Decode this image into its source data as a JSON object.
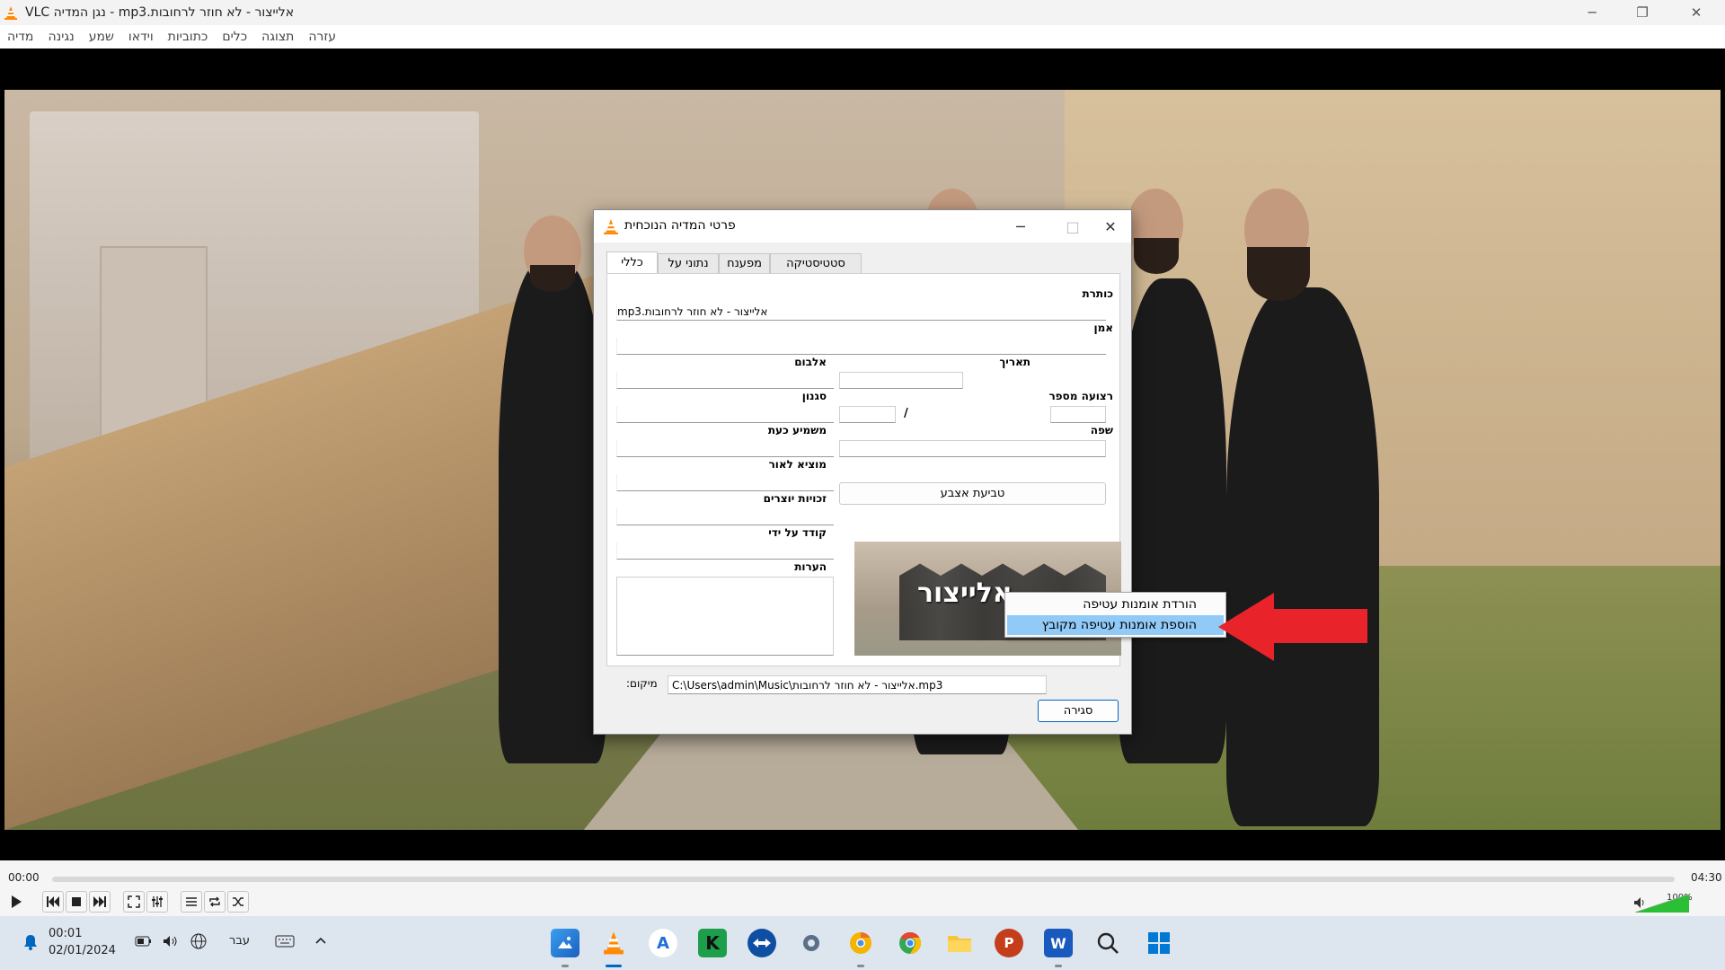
{
  "window": {
    "title": "אלייצור - לא חוזר לרחובות.mp3 - נגן המדיה VLC",
    "minimize": "─",
    "restore": "❐",
    "close": "✕"
  },
  "menu": [
    "מדיה",
    "נגינה",
    "שמע",
    "וידאו",
    "כתוביות",
    "כלים",
    "תצוגה",
    "עזרה"
  ],
  "dialog": {
    "title": "פרטי המדיה הנוכחית",
    "tabs": [
      "כללי",
      "נתוני על",
      "מפענח",
      "סטטיסטיקה"
    ],
    "fields": {
      "title_label": "כותרת",
      "title_value": "אלייצור - לא חוזר לרחובות.mp3",
      "artist_label": "אמן",
      "album_label": "אלבום",
      "date_label": "תאריך",
      "genre_label": "סגנון",
      "track_label": "רצועה מספר",
      "track_sep": "/",
      "now_playing_label": "משמיע כעת",
      "language_label": "שפה",
      "publisher_label": "מוציא לאור",
      "copyright_label": "זכויות יוצרים",
      "encoded_by_label": "קודד על ידי",
      "comments_label": "הערות"
    },
    "fingerprint_button": "טביעת אצבע",
    "art_text": "אלייצור",
    "location_label": "מיקום:",
    "location_value": "C:\\Users\\admin\\Music\\אלייצור - לא חוזר לרחובות.mp3",
    "close_button": "סגירה"
  },
  "context_menu": {
    "items": [
      {
        "label": "הורדת אומנות עטיפה",
        "highlighted": false
      },
      {
        "label": "הוספת אומנות עטיפה מקובץ",
        "highlighted": true
      }
    ]
  },
  "player": {
    "elapsed": "00:00",
    "total": "04:30",
    "progress_fraction": 0.0,
    "volume_label": "100%",
    "volume_fraction": 1.0
  },
  "taskbar": {
    "time": "00:01",
    "date": "02/01/2024",
    "language": "עבר",
    "apps": [
      "photos-icon",
      "vlc-icon",
      "app-store-icon",
      "kleopatra-icon",
      "teamviewer-icon",
      "settings-icon",
      "chrome-canary-icon",
      "chrome-icon",
      "file-explorer-icon",
      "powerpoint-icon",
      "word-icon",
      "search-icon",
      "start-icon"
    ]
  },
  "colors": {
    "accent_blue": "#0067c0",
    "menu_highlight": "#91c9f7",
    "arrow_red": "#e8232a",
    "vlc_orange": "#ff8800"
  }
}
